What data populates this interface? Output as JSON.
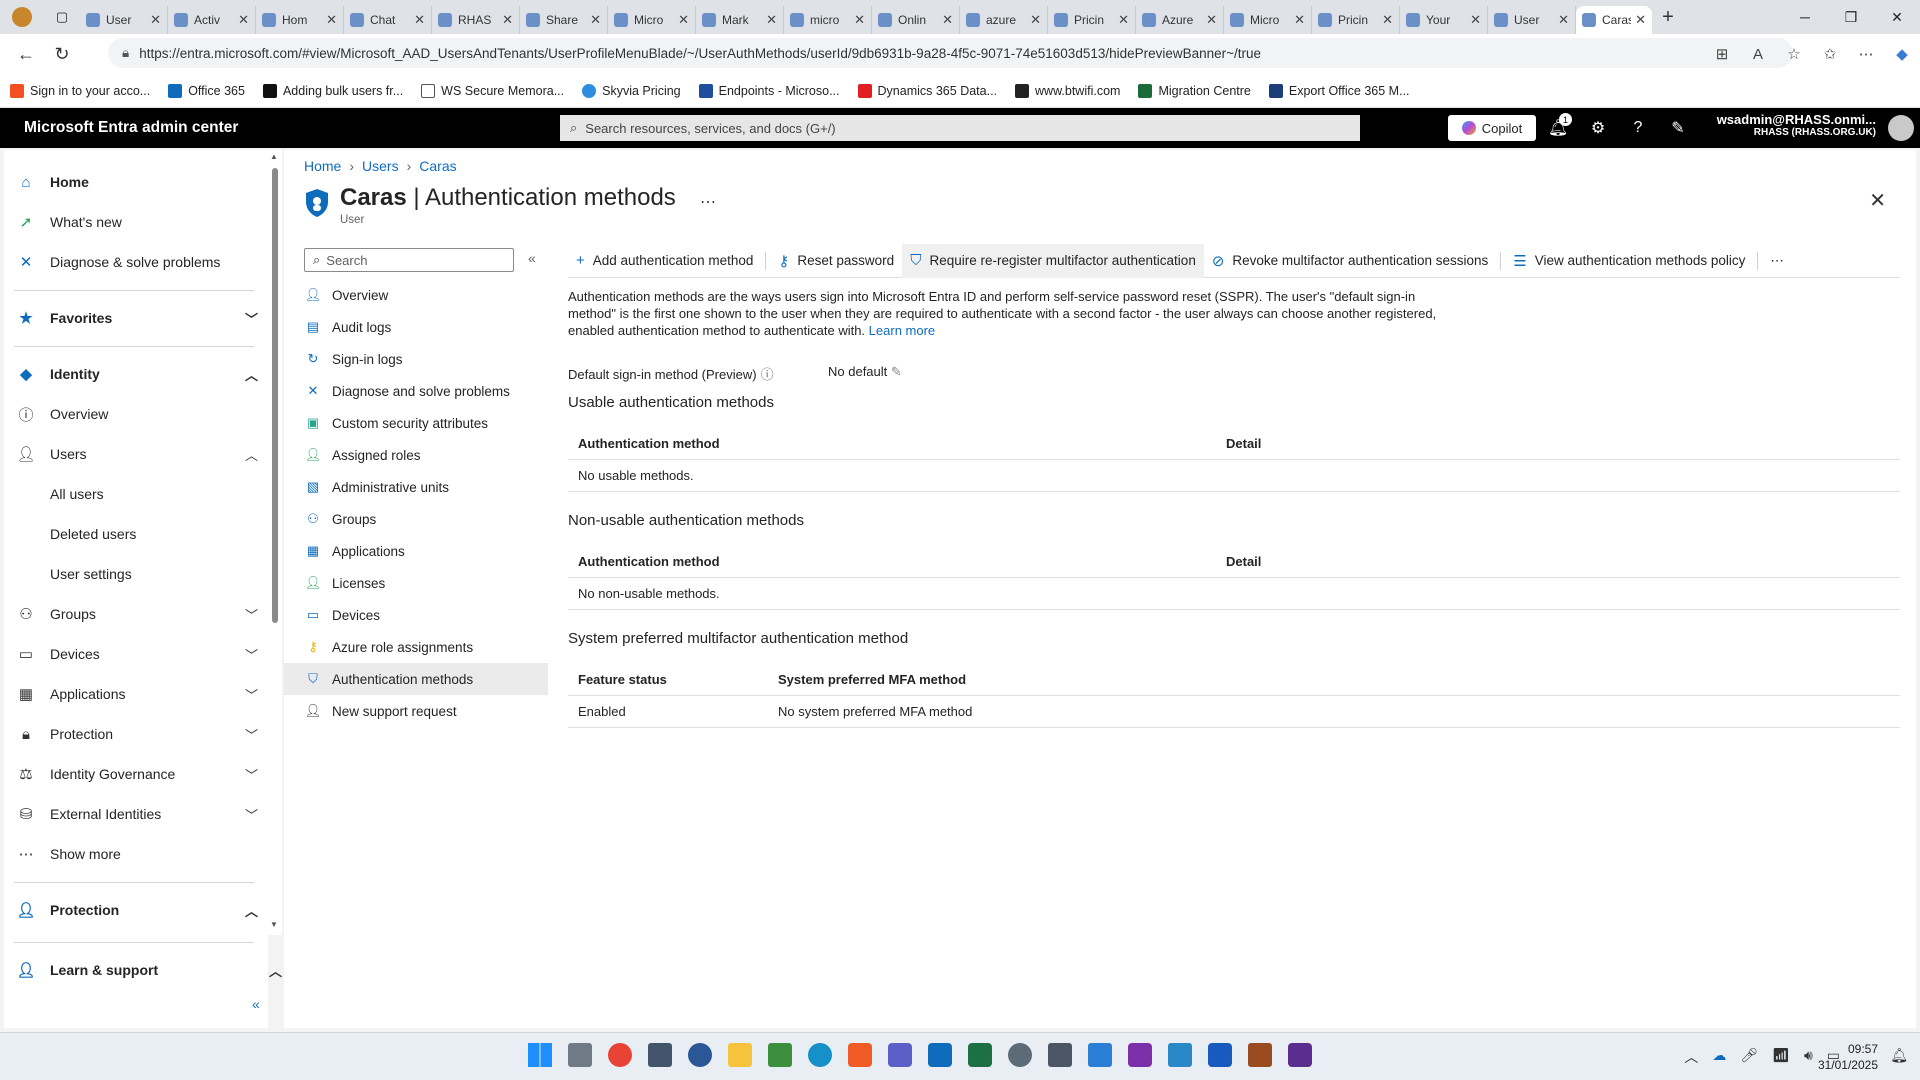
{
  "browser": {
    "tabs": [
      {
        "label": "User"
      },
      {
        "label": "Activ"
      },
      {
        "label": "Hom"
      },
      {
        "label": "Chat"
      },
      {
        "label": "RHAS"
      },
      {
        "label": "Share"
      },
      {
        "label": "Micro"
      },
      {
        "label": "Mark"
      },
      {
        "label": "micro"
      },
      {
        "label": "Onlin"
      },
      {
        "label": "azure"
      },
      {
        "label": "Pricin"
      },
      {
        "label": "Azure"
      },
      {
        "label": "Micro"
      },
      {
        "label": "Pricin"
      },
      {
        "label": "Your"
      },
      {
        "label": "User"
      },
      {
        "label": "Caras"
      }
    ],
    "url": "https://entra.microsoft.com/#view/Microsoft_AAD_UsersAndTenants/UserProfileMenuBlade/~/UserAuthMethods/userId/9db6931b-9a28-4f5c-9071-74e51603d513/hidePreviewBanner~/true",
    "bookmarks": [
      "Sign in to your acco...",
      "Office 365",
      "Adding bulk users fr...",
      "WS Secure Memora...",
      "Skyvia Pricing",
      "Endpoints - Microso...",
      "Dynamics 365 Data...",
      "www.btwifi.com",
      "Migration Centre",
      "Export Office 365 M..."
    ]
  },
  "portal": {
    "title": "Microsoft Entra admin center",
    "search_placeholder": "Search resources, services, and docs (G+/)",
    "copilot_label": "Copilot",
    "notification_count": "1",
    "account_name": "wsadmin@RHASS.onmi...",
    "account_tenant": "RHASS (RHASS.ORG.UK)"
  },
  "leftnav": {
    "home": "Home",
    "whats_new": "What's new",
    "diagnose": "Diagnose & solve problems",
    "favorites": "Favorites",
    "identity": "Identity",
    "overview": "Overview",
    "users": "Users",
    "all_users": "All users",
    "deleted_users": "Deleted users",
    "user_settings": "User settings",
    "groups": "Groups",
    "devices": "Devices",
    "applications": "Applications",
    "protection": "Protection",
    "identity_governance": "Identity Governance",
    "external_identities": "External Identities",
    "show_more": "Show more",
    "protection_section": "Protection",
    "learn_support": "Learn & support"
  },
  "breadcrumb": [
    "Home",
    "Users",
    "Caras"
  ],
  "page": {
    "title_name": "Caras",
    "title_rest": " | Authentication methods",
    "subtitle": "User"
  },
  "resource_menu": {
    "search_placeholder": "Search",
    "items": [
      "Overview",
      "Audit logs",
      "Sign-in logs",
      "Diagnose and solve problems",
      "Custom security attributes",
      "Assigned roles",
      "Administrative units",
      "Groups",
      "Applications",
      "Licenses",
      "Devices",
      "Azure role assignments",
      "Authentication methods",
      "New support request"
    ]
  },
  "commands": {
    "add": "Add authentication method",
    "reset": "Reset password",
    "require": "Require re-register multifactor authentication",
    "revoke": "Revoke multifactor authentication sessions",
    "view_policy": "View authentication methods policy"
  },
  "content": {
    "description": "Authentication methods are the ways users sign into Microsoft Entra ID and perform self-service password reset (SSPR). The user's \"default sign-in method\" is the first one shown to the user when they are required to authenticate with a second factor - the user always can choose another registered, enabled authentication method to authenticate with.",
    "learn_more": "Learn more",
    "default_label": "Default sign-in method (Preview)",
    "default_value": "No default",
    "usable_title": "Usable authentication methods",
    "usable_headers": [
      "Authentication method",
      "Detail"
    ],
    "usable_empty": "No usable methods.",
    "nonusable_title": "Non-usable authentication methods",
    "nonusable_headers": [
      "Authentication method",
      "Detail"
    ],
    "nonusable_empty": "No non-usable methods.",
    "mfa_title": "System preferred multifactor authentication method",
    "mfa_headers": [
      "Feature status",
      "System preferred MFA method"
    ],
    "mfa_row": [
      "Enabled",
      "No system preferred MFA method"
    ]
  },
  "taskbar": {
    "time": "09:57",
    "date": "31/01/2025"
  }
}
